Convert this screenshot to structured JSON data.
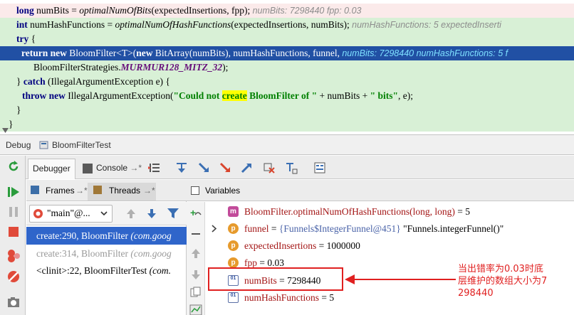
{
  "editor": {
    "lines": [
      {
        "kind": "pink",
        "segments": [
          {
            "t": "long ",
            "c": "kw"
          },
          {
            "t": "numBits = "
          },
          {
            "t": "optimalNumOfBits",
            "c": "it"
          },
          {
            "t": "(expectedInsertions, fpp);  "
          },
          {
            "t": "numBits: 7298440  fpp: 0.03",
            "c": "inl"
          }
        ]
      },
      {
        "kind": "green",
        "segments": [
          {
            "t": "int ",
            "c": "kw"
          },
          {
            "t": "numHashFunctions = "
          },
          {
            "t": "optimalNumOfHashFunctions",
            "c": "it"
          },
          {
            "t": "(expectedInsertions, numBits);  "
          },
          {
            "t": "numHashFunctions: 5  expectedInserti",
            "c": "inl"
          }
        ]
      },
      {
        "kind": "green",
        "segments": [
          {
            "t": "try",
            "c": "kw"
          },
          {
            "t": " {"
          }
        ]
      },
      {
        "kind": "sel",
        "segments": [
          {
            "t": "return new ",
            "c": "kw"
          },
          {
            "t": "BloomFilter<T>("
          },
          {
            "t": "new ",
            "c": "kw"
          },
          {
            "t": "BitArray(numBits), numHashFunctions, funnel,  "
          },
          {
            "t": "numBits: 7298440  numHashFunctions: 5  f",
            "c": "inl"
          }
        ]
      },
      {
        "kind": "green",
        "segments": [
          {
            "t": "BloomFilterStrategies."
          },
          {
            "t": "MURMUR128_MITZ_32",
            "c": "const"
          },
          {
            "t": ");"
          }
        ]
      },
      {
        "kind": "green",
        "segments": [
          {
            "t": "} "
          },
          {
            "t": "catch ",
            "c": "kw"
          },
          {
            "t": "(IllegalArgumentException e) {"
          }
        ]
      },
      {
        "kind": "green",
        "segments": [
          {
            "t": "throw new ",
            "c": "kw"
          },
          {
            "t": "IllegalArgumentException("
          },
          {
            "t": "\"Could not ",
            "c": "str"
          },
          {
            "t": "create",
            "c": "str hl"
          },
          {
            "t": " BloomFilter of \" ",
            "c": "str"
          },
          {
            "t": "+ numBits + "
          },
          {
            "t": "\" bits\"",
            "c": "str"
          },
          {
            "t": ", e);"
          }
        ]
      },
      {
        "kind": "green",
        "segments": [
          {
            "t": "}"
          }
        ]
      },
      {
        "kind": "green",
        "segments": [
          {
            "t": "}"
          }
        ]
      }
    ]
  },
  "debug": {
    "label": "Debug",
    "config_name": "BloomFilterTest",
    "tabs": {
      "debugger": "Debugger",
      "console": "Console",
      "console_arrow": "→*"
    }
  },
  "frames": {
    "tab_frames": "Frames",
    "tab_frames_arrow": "→*",
    "tab_threads": "Threads",
    "tab_threads_arrow": "→*",
    "thread_selector": "\"main\"@...",
    "rows": [
      {
        "method": "create:290, BloomFilter ",
        "pkg": "(com.goog",
        "state": "sel"
      },
      {
        "method": "create:314, BloomFilter ",
        "pkg": "(com.goog",
        "state": "dim"
      },
      {
        "method": "<clinit>:22, BloomFilterTest ",
        "pkg": "(com.",
        "state": "normal"
      }
    ]
  },
  "variables": {
    "title": "Variables",
    "rows": [
      {
        "icon": "m",
        "icon_text": "m",
        "expand": "",
        "name": "BloomFilter.optimalNumOfHashFunctions(long, long)",
        "eq": " = ",
        "value": "5",
        "vclass": "plain",
        "extra": ""
      },
      {
        "icon": "orange",
        "icon_text": "p",
        "expand": ">",
        "name": "funnel",
        "eq": " = ",
        "value": "{Funnels$IntegerFunnel@451}",
        "vclass": "vobj",
        "extra": " \"Funnels.integerFunnel()\""
      },
      {
        "icon": "orange",
        "icon_text": "p",
        "expand": "",
        "name": "expectedInsertions",
        "eq": " = ",
        "value": "1000000",
        "vclass": "plain",
        "extra": ""
      },
      {
        "icon": "orange",
        "icon_text": "p",
        "expand": "",
        "name": "fpp",
        "eq": " = ",
        "value": "0.03",
        "vclass": "plain",
        "extra": ""
      },
      {
        "icon": "arr",
        "icon_text": "01",
        "expand": "",
        "name": "numBits",
        "eq": " = ",
        "value": "7298440",
        "vclass": "plain",
        "extra": ""
      },
      {
        "icon": "arr",
        "icon_text": "01",
        "expand": "",
        "name": "numHashFunctions",
        "eq": " = ",
        "value": "5",
        "vclass": "plain",
        "extra": ""
      }
    ]
  },
  "annotation": {
    "line1": "当出错率为0.03时底",
    "line2": "层维护的数组大小为7",
    "line3": "298440",
    "color": "#e02020"
  }
}
